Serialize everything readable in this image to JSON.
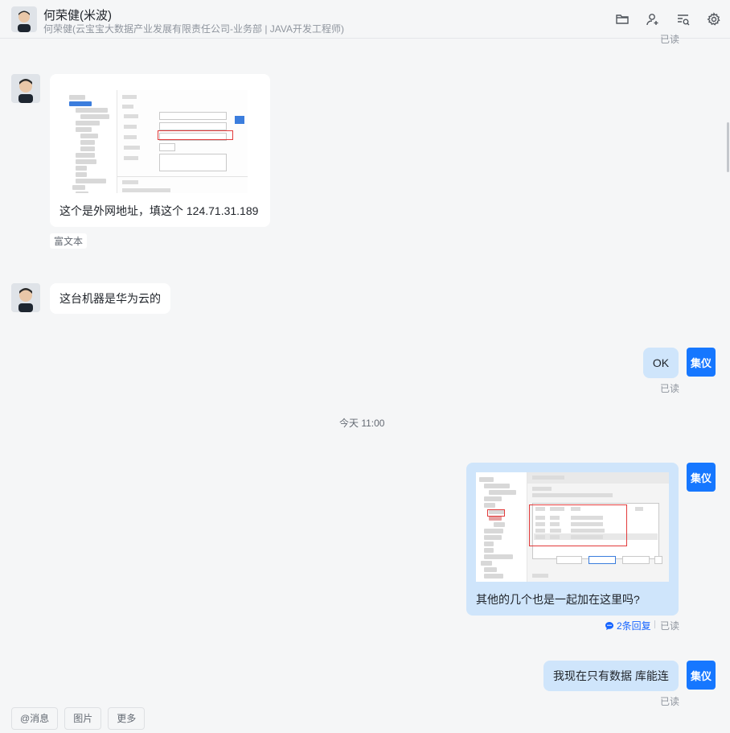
{
  "header": {
    "name": "何荣健(米波)",
    "subtitle": "何荣健(云宝宝大数据产业发展有限责任公司-业务部 | JAVA开发工程师)",
    "icons": [
      "folder-icon",
      "add-user-icon",
      "search-list-icon",
      "settings-icon"
    ]
  },
  "top_read": "已读",
  "messages": {
    "m1": {
      "text": "这个是外网地址，填这个 124.71.31.189",
      "tag": "富文本"
    },
    "m2": {
      "text": "这台机器是华为云的"
    },
    "m3": {
      "text": "OK",
      "avatar": "集仪",
      "read": "已读"
    },
    "time_divider": "今天 11:00",
    "m4": {
      "text": "其他的几个也是一起加在这里吗?",
      "avatar": "集仪",
      "replies": "2条回复",
      "read": "已读"
    },
    "m5": {
      "text": "我现在只有数据 库能连",
      "avatar": "集仪",
      "read": "已读"
    }
  },
  "toolbar": {
    "mention": "@消息",
    "image": "图片",
    "more": "更多"
  },
  "colors": {
    "accent": "#1677ff",
    "bubble_out": "#cfe5fb",
    "bubble_in": "#ffffff",
    "background": "#f5f6f7"
  }
}
